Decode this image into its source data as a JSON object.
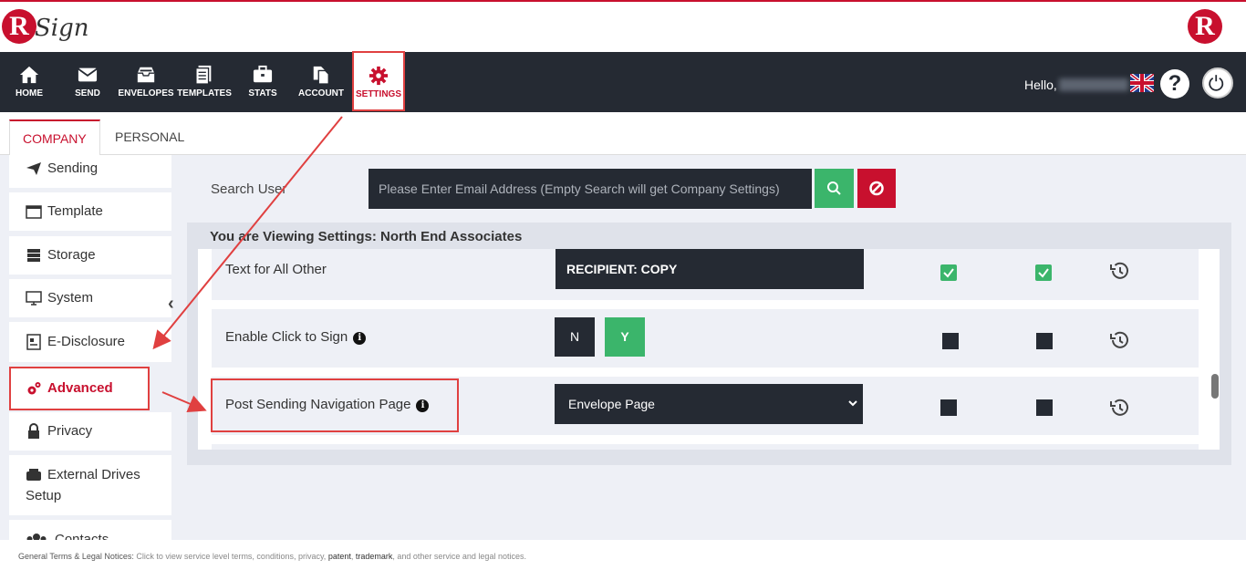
{
  "brand": {
    "logo_letter": "R",
    "logo_script": "Sign",
    "right_logo_letter": "R",
    "accent_color": "#c8102e"
  },
  "nav": {
    "items": [
      {
        "label": "HOME",
        "icon": "home-icon"
      },
      {
        "label": "SEND",
        "icon": "envelope-icon"
      },
      {
        "label": "ENVELOPES",
        "icon": "inbox-icon"
      },
      {
        "label": "TEMPLATES",
        "icon": "document-icon"
      },
      {
        "label": "STATS",
        "icon": "briefcase-icon"
      },
      {
        "label": "ACCOUNT",
        "icon": "copy-icon"
      },
      {
        "label": "SETTINGS",
        "icon": "gear-icon"
      }
    ],
    "active": "SETTINGS",
    "hello": "Hello,",
    "help_symbol": "?"
  },
  "tabs": {
    "company": "COMPANY",
    "personal": "PERSONAL",
    "active": "COMPANY"
  },
  "sidebar": {
    "items": [
      {
        "label": "Sending",
        "icon": "paper-plane-icon"
      },
      {
        "label": "Template",
        "icon": "window-icon"
      },
      {
        "label": "Storage",
        "icon": "database-icon"
      },
      {
        "label": "System",
        "icon": "monitor-icon"
      },
      {
        "label": "E-Disclosure",
        "icon": "disclosure-icon"
      },
      {
        "label": "Advanced",
        "icon": "gears-icon"
      },
      {
        "label": "Privacy",
        "icon": "lock-icon"
      },
      {
        "label": "External Drives",
        "label2": "Setup",
        "icon": "drive-icon"
      },
      {
        "label": "Contacts",
        "icon": "users-icon"
      }
    ],
    "active": "Advanced",
    "collapse_symbol": "‹"
  },
  "search": {
    "label": "Search User",
    "placeholder": "Please Enter Email Address (Empty Search will get Company Settings)",
    "value": ""
  },
  "panel": {
    "title": "You are Viewing Settings: North End Associates",
    "rows": [
      {
        "label": "Text for All Other",
        "field": "RECIPIENT: COPY",
        "check1": true,
        "check2": true
      },
      {
        "label": "Enable Click to Sign",
        "info": "i",
        "toggle_no": "N",
        "toggle_yes": "Y",
        "selected": "Y",
        "check1": false,
        "check2": false
      },
      {
        "label": "Post Sending Navigation Page",
        "info": "i",
        "select_value": "Envelope Page",
        "check1": false,
        "check2": false
      }
    ]
  },
  "footer": {
    "prefix": "General Terms & Legal Notices:",
    "text": " Click to view service level terms, conditions, privacy, ",
    "link1": "patent",
    "sep": ", ",
    "link2": "trademark",
    "suffix": ", and other service and legal notices."
  }
}
